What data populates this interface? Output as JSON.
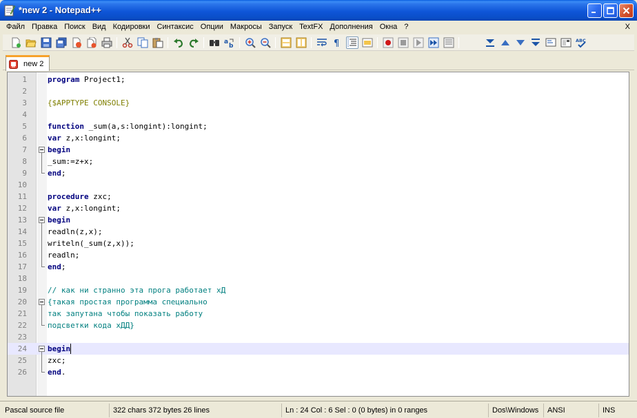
{
  "window": {
    "title": "*new  2 - Notepad++",
    "controls": {
      "minimize": "minimize-icon",
      "maximize": "maximize-icon",
      "close": "close-icon"
    }
  },
  "menu": {
    "items": [
      "Файл",
      "Правка",
      "Поиск",
      "Вид",
      "Кодировки",
      "Синтаксис",
      "Опции",
      "Макросы",
      "Запуск",
      "TextFX",
      "Дополнения",
      "Окна",
      "?"
    ],
    "close_doc": "X"
  },
  "toolbar": {
    "buttons": [
      "new-file-icon",
      "open-file-icon",
      "save-icon",
      "save-all-icon",
      "close-icon",
      "close-all-icon",
      "print-icon",
      "cut-icon",
      "copy-icon",
      "paste-icon",
      "undo-icon",
      "redo-icon",
      "find-icon",
      "replace-icon",
      "zoom-in-icon",
      "zoom-out-icon",
      "sync-vertical-icon",
      "sync-horizontal-icon",
      "word-wrap-icon",
      "show-all-chars-icon",
      "indent-guide-icon",
      "user-lang-icon",
      "record-macro-icon",
      "stop-record-icon",
      "play-macro-icon",
      "run-macro-multiple-icon",
      "save-macro-icon",
      "collapse-icon",
      "prev-bookmark-icon",
      "next-bookmark-icon",
      "expand-icon",
      "monitor-icon",
      "doc-map-icon",
      "spell-check-icon"
    ]
  },
  "tabs": [
    {
      "label": "new  2",
      "active": true,
      "modified": true
    }
  ],
  "editor": {
    "current_line": 24,
    "lines": [
      {
        "n": "1",
        "segs": [
          {
            "t": "program",
            "c": "kw"
          },
          {
            "t": " Project1;",
            "c": "plain"
          }
        ]
      },
      {
        "n": "2",
        "segs": []
      },
      {
        "n": "3",
        "segs": [
          {
            "t": "{$APPTYPE CONSOLE}",
            "c": "dir"
          }
        ]
      },
      {
        "n": "4",
        "segs": []
      },
      {
        "n": "5",
        "segs": [
          {
            "t": "function",
            "c": "kw"
          },
          {
            "t": " _sum(a,s:longint):longint;",
            "c": "plain"
          }
        ]
      },
      {
        "n": "6",
        "segs": [
          {
            "t": "var",
            "c": "kw"
          },
          {
            "t": " z,x:longint;",
            "c": "plain"
          }
        ]
      },
      {
        "n": "7",
        "segs": [
          {
            "t": "begin",
            "c": "kw"
          }
        ]
      },
      {
        "n": "8",
        "segs": [
          {
            "t": "_sum:=z+x;",
            "c": "plain"
          }
        ]
      },
      {
        "n": "9",
        "segs": [
          {
            "t": "end",
            "c": "kw"
          },
          {
            "t": ";",
            "c": "plain"
          }
        ]
      },
      {
        "n": "10",
        "segs": []
      },
      {
        "n": "11",
        "segs": [
          {
            "t": "procedure",
            "c": "kw"
          },
          {
            "t": " zxc;",
            "c": "plain"
          }
        ]
      },
      {
        "n": "12",
        "segs": [
          {
            "t": "var",
            "c": "kw"
          },
          {
            "t": " z,x:longint;",
            "c": "plain"
          }
        ]
      },
      {
        "n": "13",
        "segs": [
          {
            "t": "begin",
            "c": "kw"
          }
        ]
      },
      {
        "n": "14",
        "segs": [
          {
            "t": "readln(z,x);",
            "c": "plain"
          }
        ]
      },
      {
        "n": "15",
        "segs": [
          {
            "t": "writeln(_sum(z,x));",
            "c": "plain"
          }
        ]
      },
      {
        "n": "16",
        "segs": [
          {
            "t": "readln;",
            "c": "plain"
          }
        ]
      },
      {
        "n": "17",
        "segs": [
          {
            "t": "end",
            "c": "kw"
          },
          {
            "t": ";",
            "c": "plain"
          }
        ]
      },
      {
        "n": "18",
        "segs": []
      },
      {
        "n": "19",
        "segs": [
          {
            "t": "// как ни странно эта прога работает хД",
            "c": "cmt"
          }
        ]
      },
      {
        "n": "20",
        "segs": [
          {
            "t": "{такая простая программа специально",
            "c": "cmt"
          }
        ]
      },
      {
        "n": "21",
        "segs": [
          {
            "t": "так запутана чтобы показать работу",
            "c": "cmt"
          }
        ]
      },
      {
        "n": "22",
        "segs": [
          {
            "t": "подсветки кода хДД}",
            "c": "cmt"
          }
        ]
      },
      {
        "n": "23",
        "segs": []
      },
      {
        "n": "24",
        "segs": [
          {
            "t": "begin",
            "c": "kw"
          }
        ]
      },
      {
        "n": "25",
        "segs": [
          {
            "t": "zxc;",
            "c": "plain"
          }
        ]
      },
      {
        "n": "26",
        "segs": [
          {
            "t": "end",
            "c": "kw"
          },
          {
            "t": ".",
            "c": "plain"
          }
        ]
      }
    ]
  },
  "status": {
    "filetype": "Pascal source file",
    "stats": "322 chars   372 bytes   26 lines",
    "position": "Ln : 24    Col : 6    Sel : 0 (0 bytes) in 0 ranges",
    "eol": "Dos\\Windows",
    "encoding": "ANSI",
    "mode": "INS"
  }
}
